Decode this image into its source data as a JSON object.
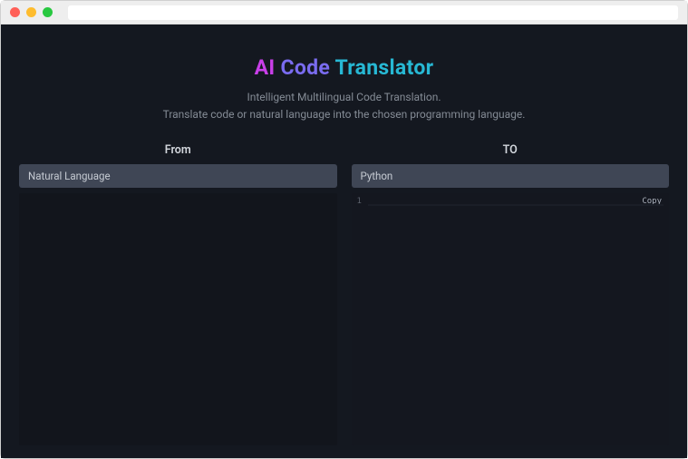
{
  "title": {
    "w1": "AI",
    "w2": "Code",
    "w3": "Translator"
  },
  "subtitle_line1": "Intelligent Multilingual Code Translation.",
  "subtitle_line2": "Translate code or natural language into the chosen programming language.",
  "from": {
    "label": "From",
    "selected": "Natural Language"
  },
  "to": {
    "label": "TO",
    "selected": "Python"
  },
  "output": {
    "line_no": "1",
    "copy_label": "Copy"
  }
}
